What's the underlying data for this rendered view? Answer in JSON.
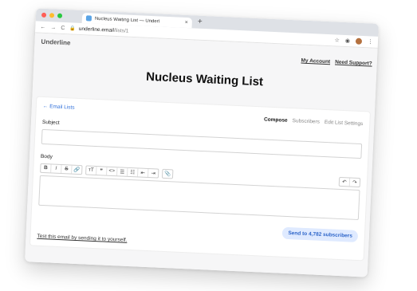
{
  "browser": {
    "tab_title": "Nucleus Waiting List — Underl",
    "tab_close": "×",
    "new_tab": "+",
    "url_host": "underline.email",
    "url_path": "/lists/1",
    "back": "←",
    "forward": "→",
    "reload": "C",
    "star": "☆",
    "menu": "⋮",
    "colors": {
      "close": "#ff5f57",
      "minimize": "#febc2e",
      "maximize": "#28c840"
    }
  },
  "app": {
    "brand": "Underline",
    "links": [
      "My Account",
      "Need Support?"
    ],
    "page_title": "Nucleus Waiting List"
  },
  "editor": {
    "back_link": "← Email Lists",
    "tabs": [
      {
        "label": "Compose",
        "active": true
      },
      {
        "label": "Subscribers",
        "active": false
      },
      {
        "label": "Edit List Settings",
        "active": false
      }
    ],
    "subject_label": "Subject",
    "subject_value": "",
    "body_label": "Body",
    "body_value": "",
    "toolbar": {
      "bold": "B",
      "italic": "I",
      "strike": "S",
      "link": "🔗",
      "heading": "тT",
      "quote": "❞",
      "code": "<>",
      "bullets": "☰",
      "numbers": "☷",
      "outdent": "⇤",
      "indent": "⇥",
      "attach": "📎",
      "undo": "↶",
      "redo": "↷"
    },
    "send_button": "Send to 4,782 subscribers",
    "test_link": "Test this email by sending it to yourself."
  }
}
